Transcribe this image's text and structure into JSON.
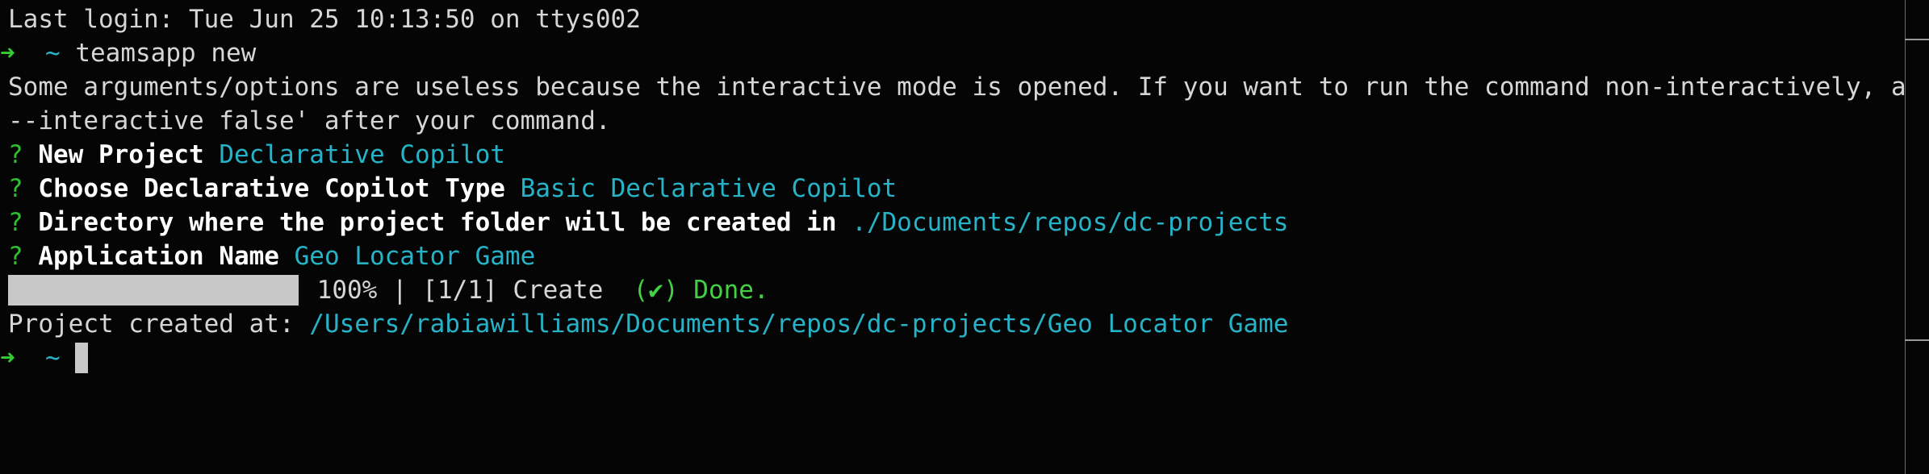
{
  "terminal": {
    "last_login": "Last login: Tue Jun 25 10:13:50 on ttys002",
    "prompt": {
      "arrow": "➜",
      "dir": "~",
      "command": "teamsapp new"
    },
    "warning_line1": "Some arguments/options are useless because the interactive mode is opened. If you want to run the command non-interactively, add '",
    "warning_line2": "--interactive false' after your command.",
    "questions": [
      {
        "mark": "?",
        "label": "New Project",
        "answer": "Declarative Copilot"
      },
      {
        "mark": "?",
        "label": "Choose Declarative Copilot Type",
        "answer": "Basic Declarative Copilot"
      },
      {
        "mark": "?",
        "label": "Directory where the project folder will be created in",
        "answer": "./Documents/repos/dc-projects"
      },
      {
        "mark": "?",
        "label": "Application Name",
        "answer": "Geo Locator Game"
      }
    ],
    "progress": {
      "percent_text": "100%",
      "separator": "|",
      "step": "[1/1] Create",
      "done": "(✔) Done.",
      "fraction": 1.0
    },
    "created_label": "Project created at:",
    "created_path": "/Users/rabiawilliams/Documents/repos/dc-projects/Geo Locator Game",
    "final_prompt": {
      "arrow": "➜",
      "dir": "~"
    }
  },
  "colors": {
    "background": "#050505",
    "text": "#d6d6d6",
    "cyan": "#27b3c7",
    "green": "#43d043",
    "bar": "#c8c8c8"
  }
}
